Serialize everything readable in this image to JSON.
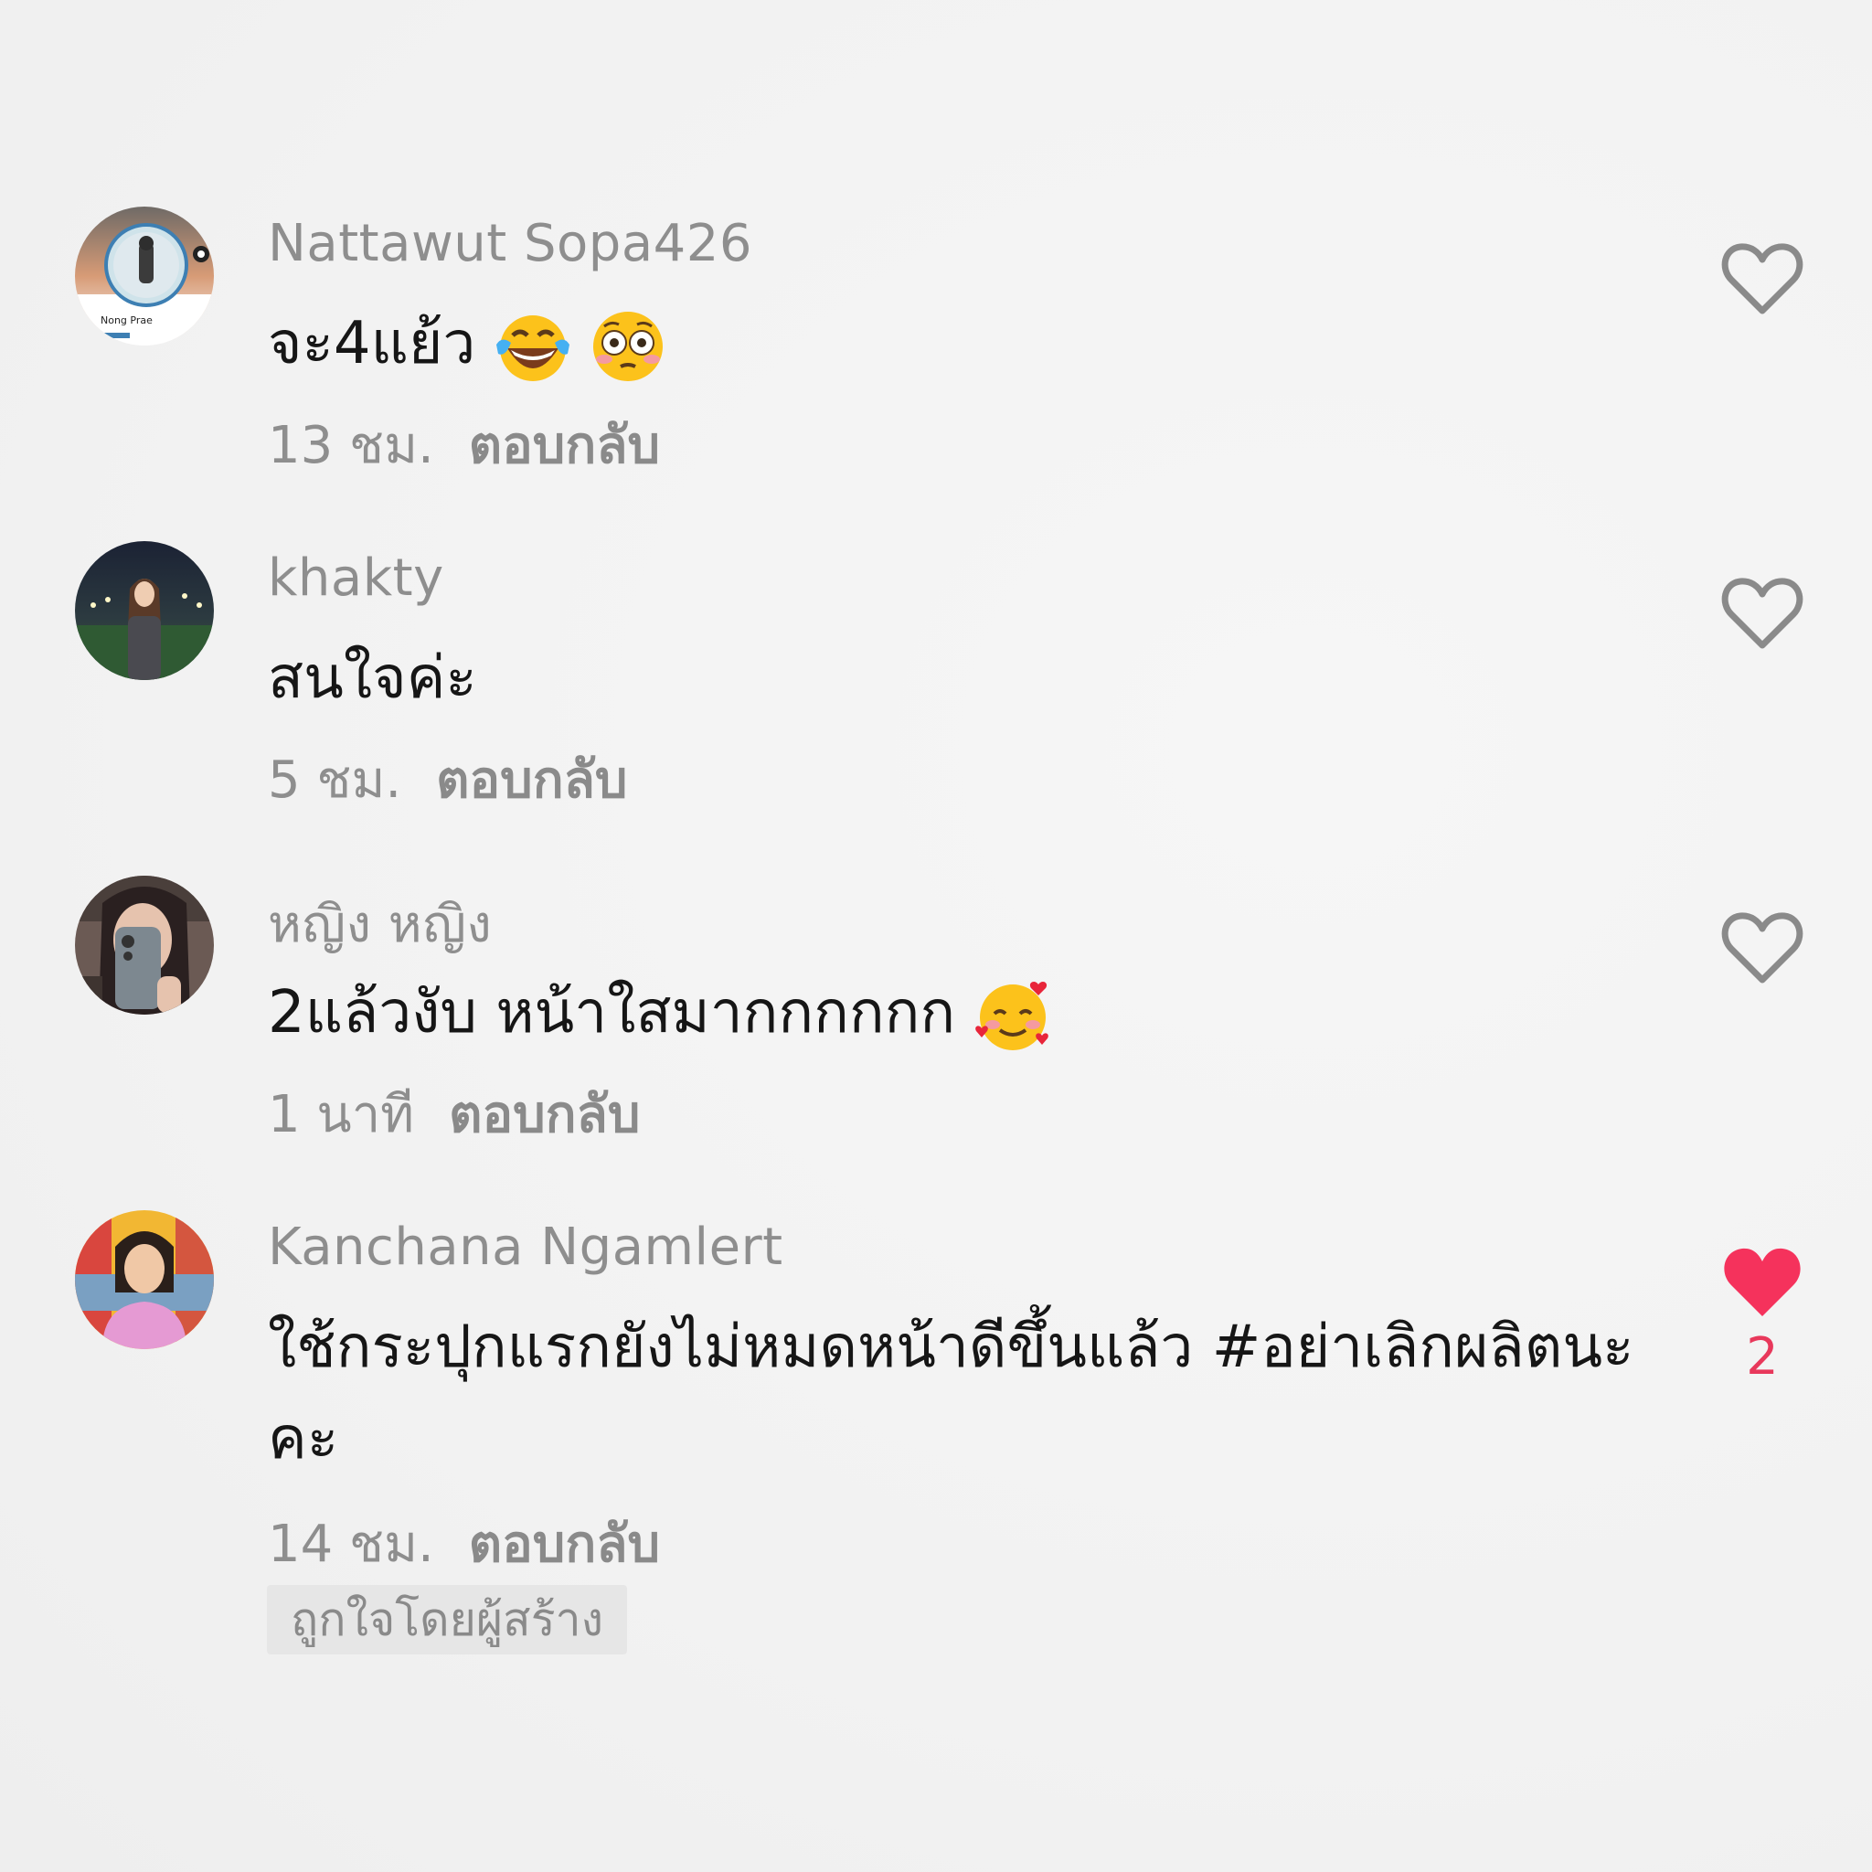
{
  "colors": {
    "liked": "#f5325c",
    "muted": "#8e8e8e",
    "text": "#161616"
  },
  "comments": [
    {
      "username": "Nattawut Sopa426",
      "text": "จะ4แย้ว",
      "emojis": [
        "face-with-tears-of-joy",
        "flushed-face"
      ],
      "time": "13 ชม.",
      "reply_label": "ตอบกลับ",
      "avatar_caption": "Nong Prae",
      "liked": false
    },
    {
      "username": "khakty",
      "text": "สนใจค่ะ",
      "emojis": [],
      "time": "5 ชม.",
      "reply_label": "ตอบกลับ",
      "liked": false
    },
    {
      "username": "หญิง หญิง",
      "text": "2แล้วงับ หน้าใสมากกกกกก",
      "emojis": [
        "smiling-face-with-hearts"
      ],
      "time": "1 นาที",
      "reply_label": "ตอบกลับ",
      "liked": false
    },
    {
      "username": "Kanchana Ngamlert",
      "text": "ใช้กระปุกแรกยังไม่หมดหน้าดีขึ้นแล้ว #อย่าเลิกผลิตนะคะ",
      "emojis": [],
      "time": "14 ชม.",
      "reply_label": "ตอบกลับ",
      "liked": true,
      "like_count": "2",
      "creator_badge": "ถูกใจโดยผู้สร้าง"
    }
  ]
}
